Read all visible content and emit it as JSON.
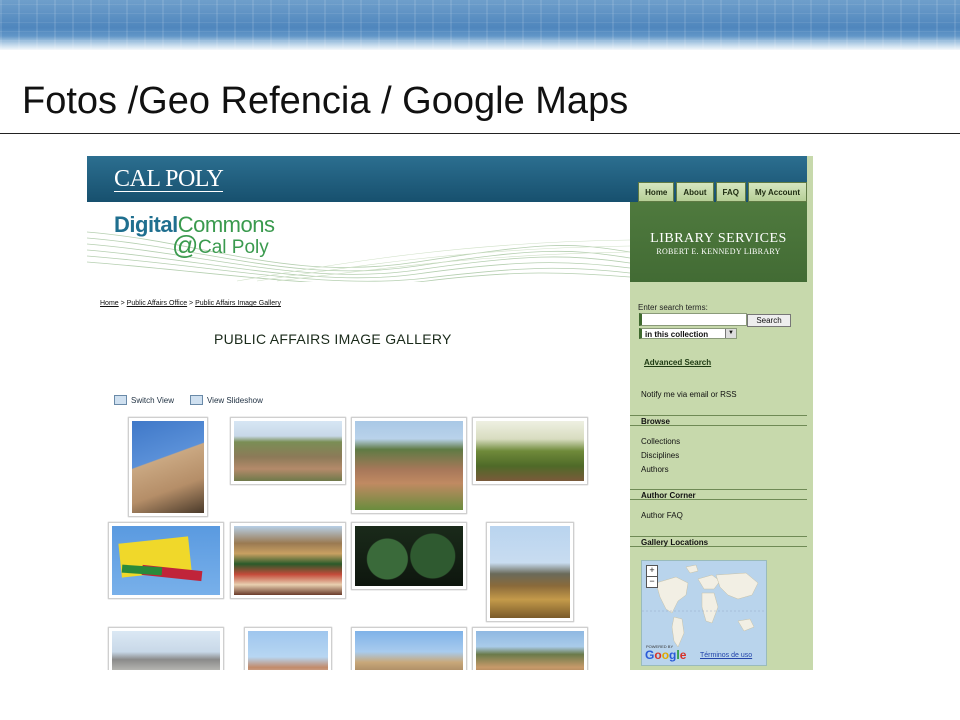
{
  "slide": {
    "title": "Fotos /Geo Refencia / Google Maps"
  },
  "site": {
    "brand": "CAL POLY",
    "nav": [
      "Home",
      "About",
      "FAQ",
      "My Account"
    ],
    "logo": {
      "line1a": "Digital",
      "line1b": "Commons",
      "at": "@",
      "line2": "Cal Poly"
    },
    "library": {
      "title": "LIBRARY SERVICES",
      "subtitle": "ROBERT E. KENNEDY LIBRARY"
    }
  },
  "breadcrumb": {
    "home": "Home",
    "sep": " > ",
    "office": "Public Affairs Office",
    "gallery": "Public Affairs Image Gallery"
  },
  "gallery": {
    "title": "PUBLIC AFFAIRS IMAGE GALLERY",
    "switch_view": "Switch View",
    "view_slideshow": "View Slideshow"
  },
  "sidebar": {
    "search_label": "Enter search terms:",
    "search_button": "Search",
    "scope_select": "in this collection",
    "advanced_search": "Advanced Search",
    "notify": "Notify me via email or RSS",
    "browse_head": "Browse",
    "browse_links": [
      "Collections",
      "Disciplines",
      "Authors"
    ],
    "author_head": "Author Corner",
    "author_links": [
      "Author FAQ"
    ],
    "locations_head": "Gallery Locations"
  },
  "map": {
    "zoom_in": "+",
    "zoom_out": "−",
    "powered": "POWERED BY",
    "terms": "Términos de uso"
  },
  "colors": {
    "header": "#17506e",
    "sidebar": "#c7d9ac",
    "library": "#426b34"
  }
}
